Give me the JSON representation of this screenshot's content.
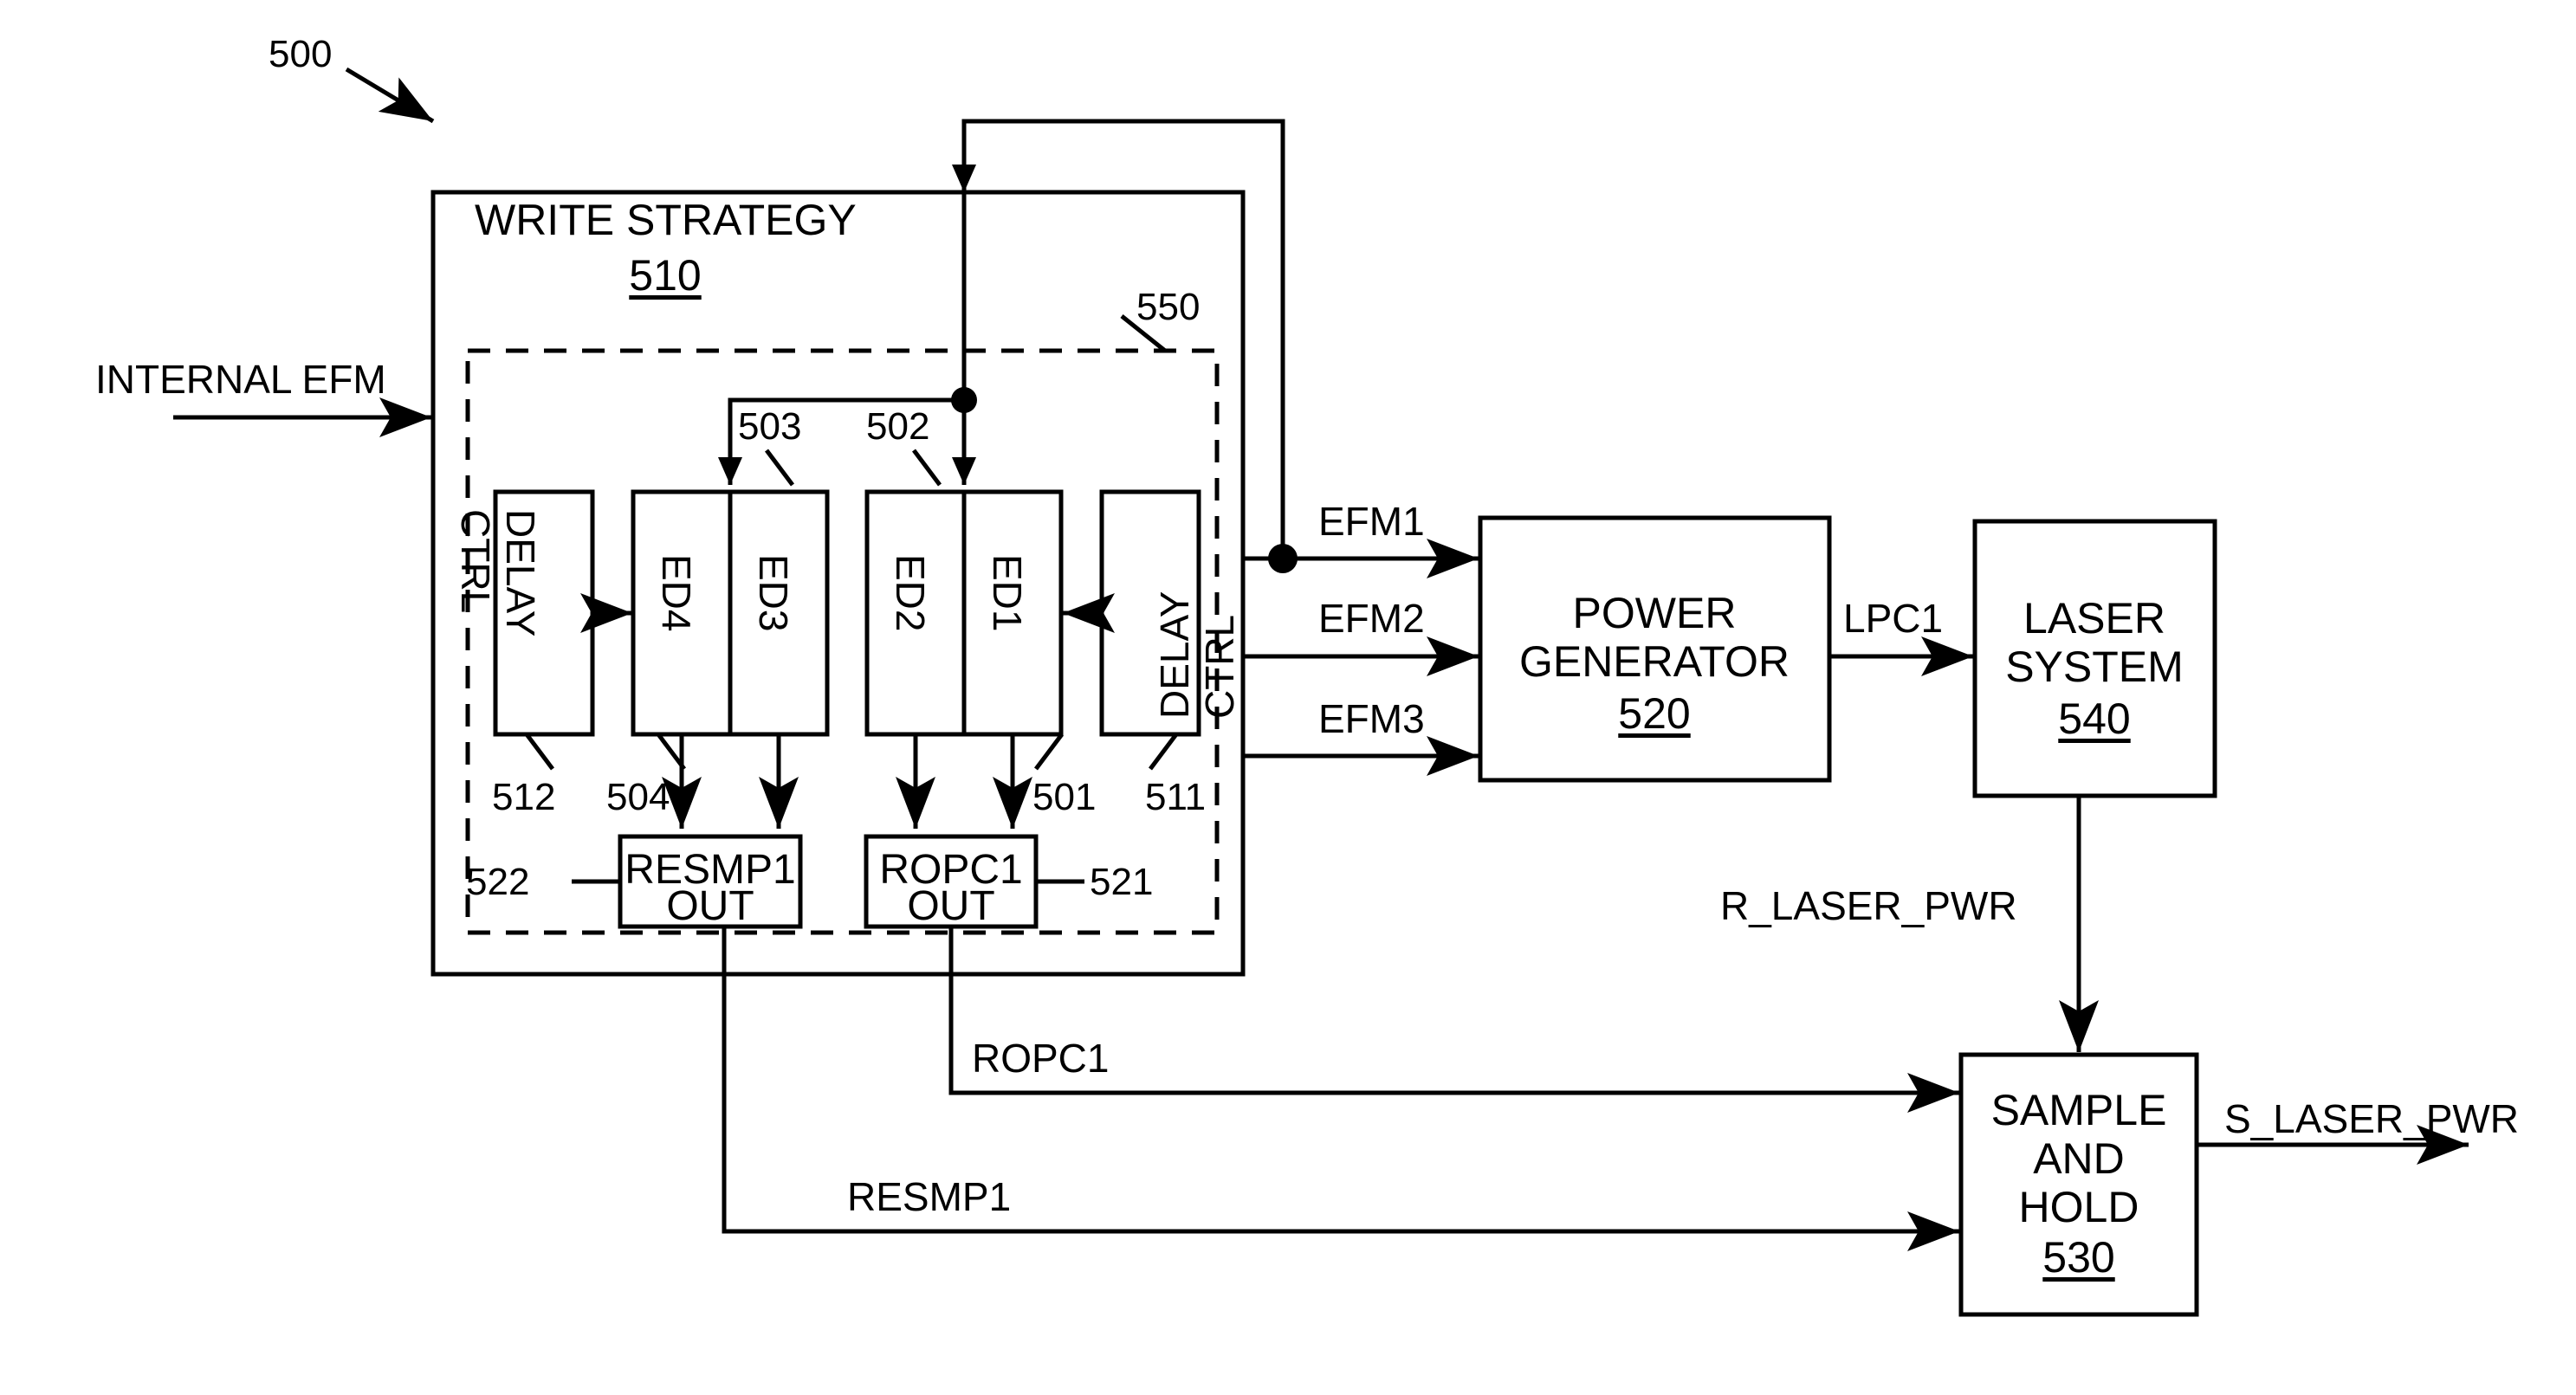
{
  "figure": {
    "number": "500",
    "type": "patent-block-diagram"
  },
  "blocks": {
    "write_strategy": {
      "title": "WRITE STRATEGY",
      "ref": "510"
    },
    "dashed_group": {
      "ref": "550"
    },
    "delay_ctrl_left": {
      "line1": "DELAY",
      "line2": "CTRL",
      "ref": "512"
    },
    "delay_ctrl_right": {
      "line1": "DELAY",
      "line2": "CTRL",
      "ref": "511"
    },
    "ed4": {
      "label": "ED4",
      "ref": "504"
    },
    "ed3": {
      "label": "ED3",
      "ref": "503"
    },
    "ed2": {
      "label": "ED2",
      "ref": "502"
    },
    "ed1": {
      "label": "ED1",
      "ref": "501"
    },
    "resmp1_out": {
      "line1": "RESMP1",
      "line2": "OUT",
      "ref": "522"
    },
    "ropc1_out": {
      "line1": "ROPC1",
      "line2": "OUT",
      "ref": "521"
    },
    "power_generator": {
      "line1": "POWER",
      "line2": "GENERATOR",
      "ref": "520"
    },
    "laser_system": {
      "line1": "LASER",
      "line2": "SYSTEM",
      "ref": "540"
    },
    "sample_and_hold": {
      "line1": "SAMPLE",
      "line2": "AND",
      "line3": "HOLD",
      "ref": "530"
    }
  },
  "signals": {
    "internal_efm": "INTERNAL EFM",
    "efm1": "EFM1",
    "efm2": "EFM2",
    "efm3": "EFM3",
    "lpc1": "LPC1",
    "r_laser_pwr": "R_LASER_PWR",
    "s_laser_pwr": "S_LASER_PWR",
    "ropc1": "ROPC1",
    "resmp1": "RESMP1"
  },
  "colors": {
    "ink": "#000000",
    "paper": "#ffffff"
  }
}
